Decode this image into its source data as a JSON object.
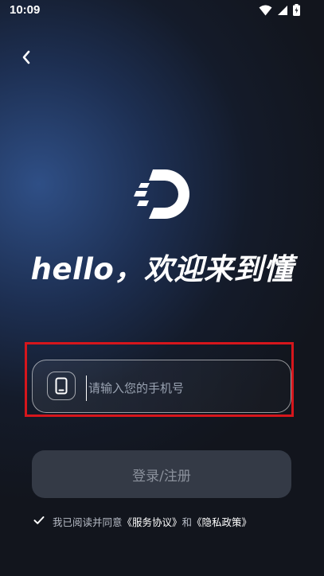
{
  "status_bar": {
    "time": "10:09",
    "icons": [
      "wifi-icon",
      "signal-icon",
      "battery-icon"
    ]
  },
  "header": {
    "back_icon": "chevron-left-icon"
  },
  "logo": {
    "icon": "dong-logo-icon"
  },
  "greeting": "hello，欢迎来到懂",
  "phone_field": {
    "icon": "phone-icon",
    "placeholder": "请输入您的手机号",
    "value": ""
  },
  "login_button": {
    "label": "登录/注册"
  },
  "agreement": {
    "checked": true,
    "prefix": "我已阅读并同意",
    "terms_link": "《服务协议》",
    "joiner": "和",
    "privacy_link": "《隐私政策》"
  },
  "colors": {
    "highlight_border": "#d6161c",
    "button_bg": "#343a46",
    "button_text": "#8b919c"
  }
}
